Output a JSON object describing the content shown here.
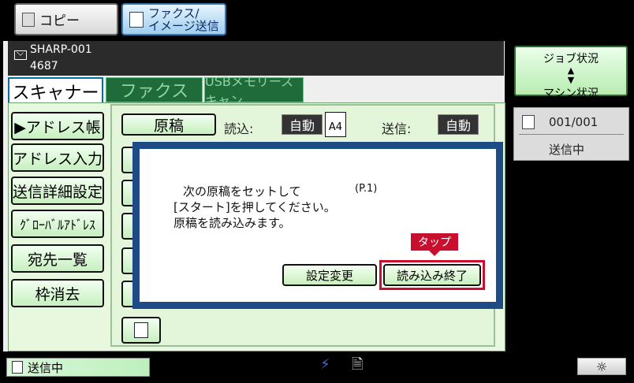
{
  "modes": {
    "copy": "コピー",
    "fax_line1": "ファクス/",
    "fax_line2": "イメージ送信"
  },
  "device": {
    "name": "SHARP-001",
    "number": "4687"
  },
  "tabs": {
    "scanner": "スキャナー",
    "fax": "ファクス",
    "usb": "USBメモリースキャン"
  },
  "left_buttons": [
    "▶アドレス帳",
    "アドレス入力",
    "送信詳細設定",
    "ｸﾞﾛｰﾊﾞﾙｱﾄﾞﾚｽ",
    "宛先一覧",
    "枠消去"
  ],
  "settings": {
    "original_button": "原稿",
    "read_label": "読込:",
    "read_value": "自動",
    "paper_size": "A4",
    "send_label": "送信:",
    "send_value": "自動"
  },
  "dialog": {
    "line1": "次の原稿をセットして",
    "page": "(P.1)",
    "line2": "[スタート]を押してください。",
    "line3": "原稿を読み込みます。",
    "change_button": "設定変更",
    "finish_button": "読み込み終了",
    "tap_label": "タップ"
  },
  "side": {
    "job_status": "ジョブ状況",
    "machine_status": "マシン状況",
    "job_count": "001/001",
    "job_state": "送信中"
  },
  "bottom": {
    "status": "送信中"
  }
}
